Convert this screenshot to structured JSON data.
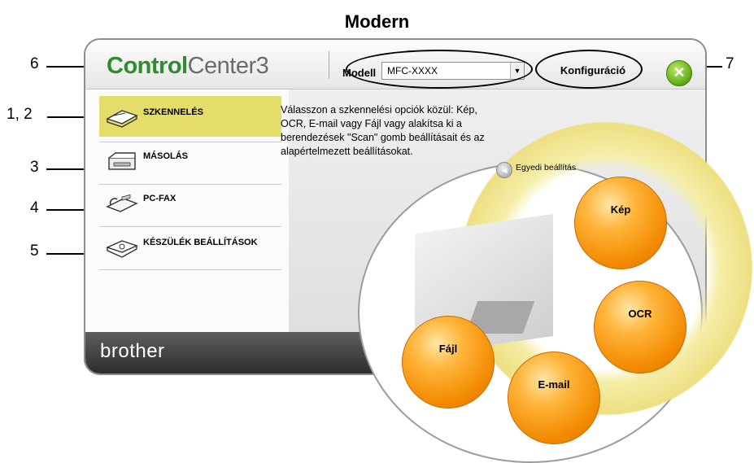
{
  "page_title": "Modern",
  "callouts": {
    "c6": "6",
    "c7": "7",
    "c12": "1, 2",
    "c3": "3",
    "c4": "4",
    "c5": "5"
  },
  "titlebar": {
    "logo_part1": "Control",
    "logo_part2": "Center",
    "logo_part3": "3",
    "model_label": "Modell",
    "model_value": "MFC-XXXX",
    "config_label": "Konfiguráció",
    "close_symbol": "✕"
  },
  "nav": {
    "items": [
      {
        "label": "SZKENNELÉS"
      },
      {
        "label": "MÁSOLÁS"
      },
      {
        "label": "PC-FAX"
      },
      {
        "label": "KÉSZÜLÉK BEÁLLÍTÁSOK"
      }
    ]
  },
  "description": "Válasszon a szkennelési opciók közül: Kép, OCR, E-mail vagy Fájl vagy alakítsa ki a berendezések \"Scan\" gomb beállításait és az alapértelmezett beállításokat.",
  "custom_setting": "Egyedi beállítás",
  "buttons": {
    "kep": "Kép",
    "ocr": "OCR",
    "email": "E-mail",
    "fajl": "Fájl"
  },
  "brand": "brother",
  "colors": {
    "accent_orange": "#f28a00",
    "active_nav": "#e4dd6a",
    "logo_green": "#2e8b2e"
  }
}
